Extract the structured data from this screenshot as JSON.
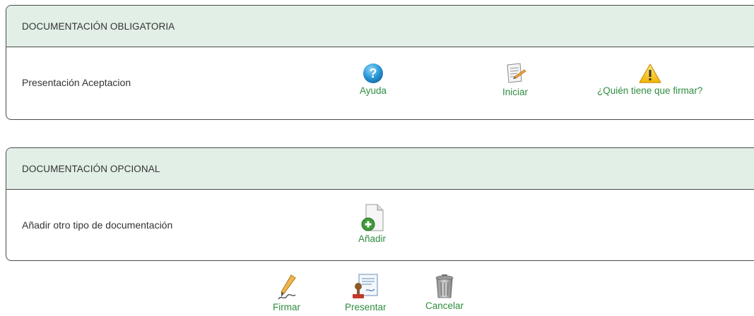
{
  "mandatory": {
    "header": "DOCUMENTACIÓN OBLIGATORIA",
    "row_label": "Presentación Aceptacion",
    "help_label": "Ayuda",
    "start_label": "Iniciar",
    "who_signs_label": "¿Quién tiene que firmar?"
  },
  "optional": {
    "header": "DOCUMENTACIÓN OPCIONAL",
    "row_label": "Añadir otro tipo de documentación",
    "add_label": "Añadir"
  },
  "footer": {
    "sign_label": "Firmar",
    "submit_label": "Presentar",
    "cancel_label": "Cancelar"
  },
  "icons": {
    "help": "help-icon",
    "start": "document-edit-icon",
    "warning": "warning-icon",
    "add": "document-add-icon",
    "sign": "pen-icon",
    "submit": "stamp-document-icon",
    "cancel": "trash-icon"
  },
  "colors": {
    "header_bg": "#e1efe6",
    "link_green": "#2f8c3f",
    "border": "#4a4a4a"
  }
}
